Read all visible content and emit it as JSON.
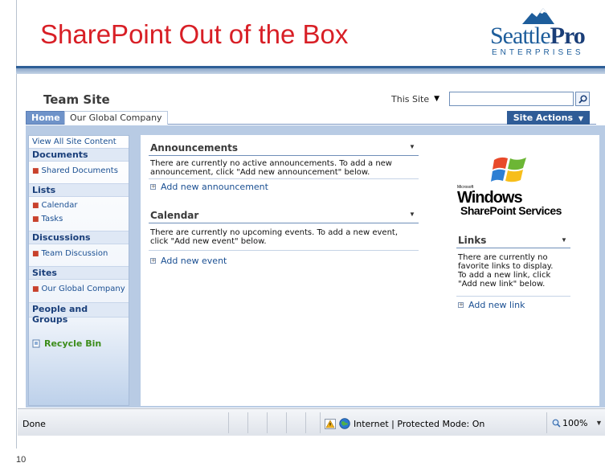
{
  "slide": {
    "title": "SharePoint Out of the Box",
    "number": "10",
    "logo": {
      "seattle": "Seattle",
      "pro": "Pro",
      "enterprises": "ENTERPRISES"
    }
  },
  "site": {
    "name": "Team Site",
    "search_scope": "This Site",
    "search_value": "",
    "tabs": [
      "Home",
      "Our Global Company"
    ],
    "site_actions_label": "Site Actions"
  },
  "leftnav": {
    "view_all": "View All Site Content",
    "sections": [
      {
        "heading": "Documents",
        "items": [
          "Shared Documents"
        ]
      },
      {
        "heading": "Lists",
        "items": [
          "Calendar",
          "Tasks"
        ]
      },
      {
        "heading": "Discussions",
        "items": [
          "Team Discussion"
        ]
      },
      {
        "heading": "Sites",
        "items": [
          "Our Global Company"
        ]
      },
      {
        "heading": "People and Groups",
        "items": []
      }
    ],
    "recycle_bin": "Recycle Bin"
  },
  "webparts": {
    "announcements": {
      "title": "Announcements",
      "message": "There are currently no active announcements. To add a new announcement, click \"Add new announcement\" below.",
      "add_link": "Add new announcement"
    },
    "calendar": {
      "title": "Calendar",
      "message": "There are currently no upcoming events. To add a new event, click \"Add new event\" below.",
      "add_link": "Add new event"
    },
    "links": {
      "title": "Links",
      "message": "There are currently no favorite links to display. To add a new link, click \"Add new link\" below.",
      "add_link": "Add new link"
    },
    "wss_logo": {
      "microsoft": "Microsoft",
      "windows": "Windows",
      "product": "SharePoint Services"
    }
  },
  "statusbar": {
    "status": "Done",
    "zone": "Internet | Protected Mode: On",
    "zoom": "100%"
  },
  "colors": {
    "title_red": "#d81f26",
    "brand_blue": "#2f5c97",
    "nav_blue": "#1a4f92",
    "recycle_green": "#3c8d1b"
  }
}
